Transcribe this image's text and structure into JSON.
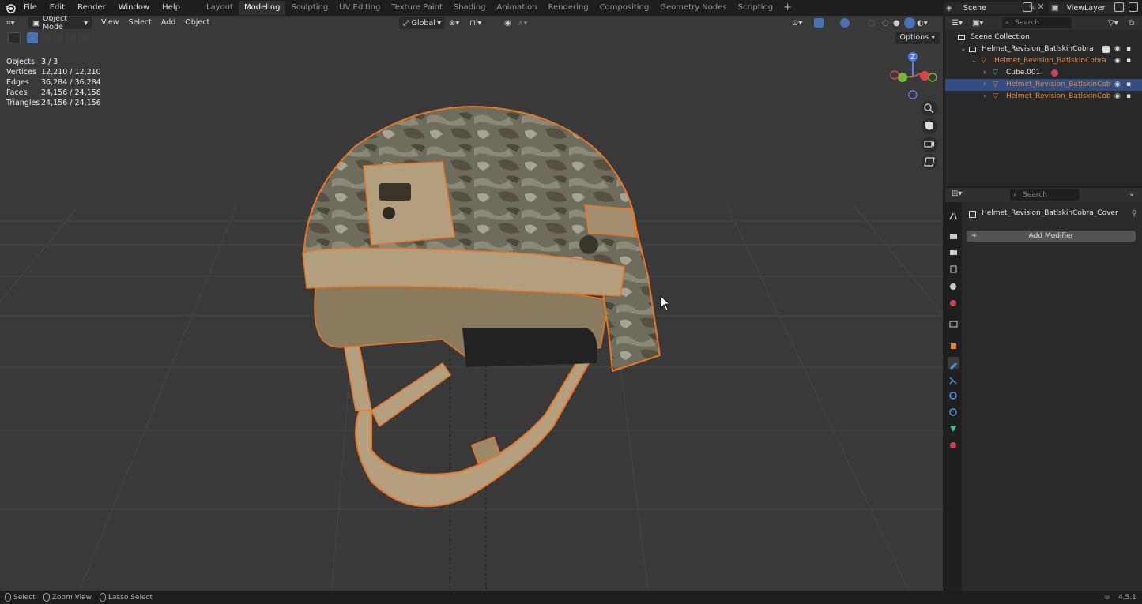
{
  "topbar": {
    "menus": [
      "File",
      "Edit",
      "Render",
      "Window",
      "Help"
    ],
    "workspaces": [
      "Layout",
      "Modeling",
      "Sculpting",
      "UV Editing",
      "Texture Paint",
      "Shading",
      "Animation",
      "Rendering",
      "Compositing",
      "Geometry Nodes",
      "Scripting"
    ],
    "active_workspace": "Modeling",
    "scene": "Scene",
    "view_layer": "ViewLayer"
  },
  "viewport": {
    "mode": "Object Mode",
    "menus": [
      "View",
      "Select",
      "Add",
      "Object"
    ],
    "orientation": "Global",
    "options": "Options",
    "stats": [
      {
        "label": "Objects",
        "value": "3 / 3"
      },
      {
        "label": "Vertices",
        "value": "12,210 / 12,210"
      },
      {
        "label": "Edges",
        "value": "36,284 / 36,284"
      },
      {
        "label": "Faces",
        "value": "24,156 / 24,156"
      },
      {
        "label": "Triangles",
        "value": "24,156 / 24,156"
      }
    ],
    "gizmo_z": "Z",
    "colors": {
      "bg": "#393939",
      "grid": "#454545",
      "outline": "#e8772a",
      "camo": "#6f6f60",
      "tan": "#b59f7f"
    }
  },
  "outliner": {
    "search_placeholder": "Search",
    "items": [
      {
        "label": "Scene Collection",
        "indent": 0,
        "type": "collection",
        "selected": false,
        "orange": false
      },
      {
        "label": "Helmet_Revision_BatlskinCobra",
        "indent": 1,
        "type": "collection",
        "selected": false,
        "orange": false
      },
      {
        "label": "Helmet_Revision_BatlskinCobra",
        "indent": 2,
        "type": "mesh",
        "selected": false,
        "orange": true
      },
      {
        "label": "Cube.001",
        "indent": 3,
        "type": "mesh-cyan",
        "selected": false,
        "orange": false
      },
      {
        "label": "Helmet_Revision_BatlskinCob",
        "indent": 3,
        "type": "mesh",
        "selected": true,
        "orange": true
      },
      {
        "label": "Helmet_Revision_BatlskinCob",
        "indent": 3,
        "type": "mesh",
        "selected": false,
        "orange": true
      }
    ]
  },
  "properties": {
    "search_placeholder": "Search",
    "object_name": "Helmet_Revision_BatlskinCobra_Cover",
    "add_modifier": "Add Modifier"
  },
  "statusbar": {
    "items": [
      "Select",
      "Zoom View",
      "Lasso Select"
    ],
    "version": "4.5.1"
  }
}
